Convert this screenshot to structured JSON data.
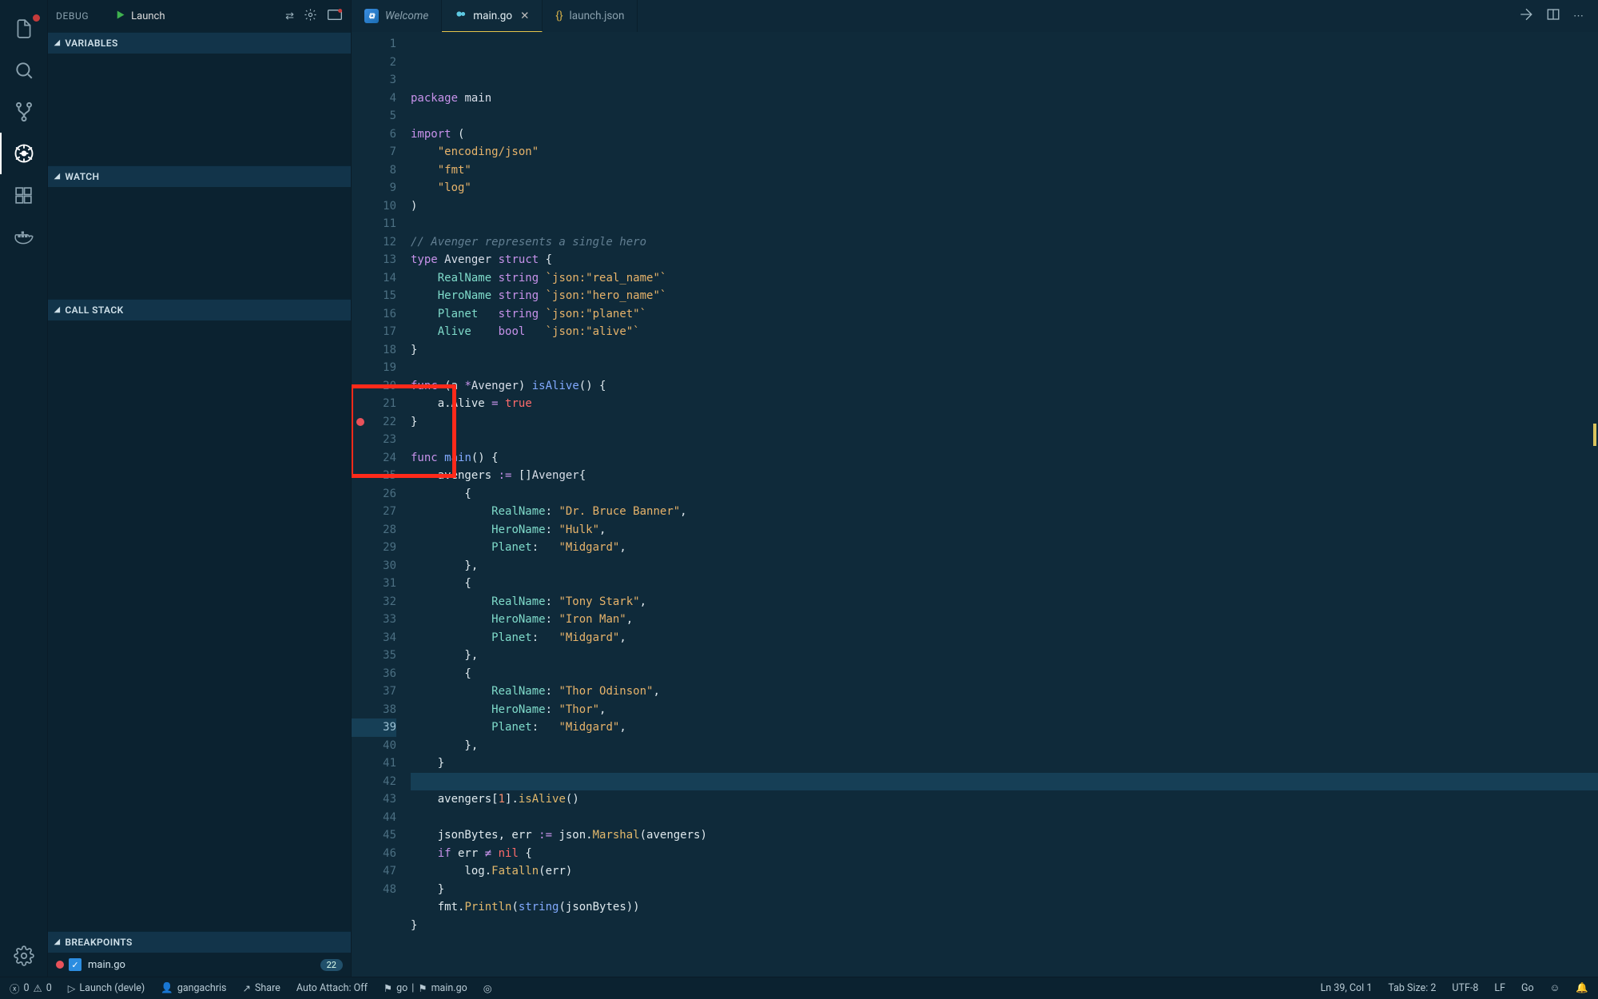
{
  "activity_bar": {
    "items": [
      "files",
      "search",
      "scm",
      "debug",
      "extensions",
      "docker"
    ],
    "active": "debug"
  },
  "sidebar": {
    "title": "DEBUG",
    "launch_config": "Launch",
    "sections": {
      "variables": "VARIABLES",
      "watch": "WATCH",
      "callstack": "CALL STACK",
      "breakpoints": "BREAKPOINTS"
    },
    "breakpoints": [
      {
        "file": "main.go",
        "line": 22,
        "enabled": true
      }
    ]
  },
  "tabs": [
    {
      "label": "Welcome",
      "icon": "vscode",
      "active": false,
      "italic": true
    },
    {
      "label": "main.go",
      "icon": "go",
      "active": true,
      "dirty": false,
      "closable": true
    },
    {
      "label": "launch.json",
      "icon": "json",
      "active": false
    }
  ],
  "editor": {
    "total_lines": 48,
    "current_line": 39,
    "breakpoint_lines": [
      22
    ],
    "code": [
      {
        "n": 1,
        "seg": [
          [
            "kw",
            "package"
          ],
          [
            "",
            " "
          ],
          [
            "pkg",
            "main"
          ]
        ]
      },
      {
        "n": 2,
        "seg": []
      },
      {
        "n": 3,
        "seg": [
          [
            "kw",
            "import"
          ],
          [
            "",
            " ("
          ]
        ]
      },
      {
        "n": 4,
        "seg": [
          [
            "",
            "    "
          ],
          [
            "str",
            "\"encoding/json\""
          ]
        ]
      },
      {
        "n": 5,
        "seg": [
          [
            "",
            "    "
          ],
          [
            "str",
            "\"fmt\""
          ]
        ]
      },
      {
        "n": 6,
        "seg": [
          [
            "",
            "    "
          ],
          [
            "str",
            "\"log\""
          ]
        ]
      },
      {
        "n": 7,
        "seg": [
          [
            "",
            ")"
          ]
        ]
      },
      {
        "n": 8,
        "seg": []
      },
      {
        "n": 9,
        "seg": [
          [
            "cm",
            "// Avenger represents a single hero"
          ]
        ]
      },
      {
        "n": 10,
        "seg": [
          [
            "kw",
            "type"
          ],
          [
            "",
            " "
          ],
          [
            "st",
            "Avenger"
          ],
          [
            "",
            " "
          ],
          [
            "kw",
            "struct"
          ],
          [
            "",
            " {"
          ]
        ]
      },
      {
        "n": 11,
        "seg": [
          [
            "",
            "    "
          ],
          [
            "fld",
            "RealName"
          ],
          [
            "",
            " "
          ],
          [
            "ty",
            "string"
          ],
          [
            "",
            " "
          ],
          [
            "str",
            "`json:\"real_name\"`"
          ]
        ]
      },
      {
        "n": 12,
        "seg": [
          [
            "",
            "    "
          ],
          [
            "fld",
            "HeroName"
          ],
          [
            "",
            " "
          ],
          [
            "ty",
            "string"
          ],
          [
            "",
            " "
          ],
          [
            "str",
            "`json:\"hero_name\"`"
          ]
        ]
      },
      {
        "n": 13,
        "seg": [
          [
            "",
            "    "
          ],
          [
            "fld",
            "Planet"
          ],
          [
            "",
            "   "
          ],
          [
            "ty",
            "string"
          ],
          [
            "",
            " "
          ],
          [
            "str",
            "`json:\"planet\"`"
          ]
        ]
      },
      {
        "n": 14,
        "seg": [
          [
            "",
            "    "
          ],
          [
            "fld",
            "Alive"
          ],
          [
            "",
            "    "
          ],
          [
            "ty",
            "bool"
          ],
          [
            "",
            "   "
          ],
          [
            "str",
            "`json:\"alive\"`"
          ]
        ]
      },
      {
        "n": 15,
        "seg": [
          [
            "",
            "}"
          ]
        ]
      },
      {
        "n": 16,
        "seg": []
      },
      {
        "n": 17,
        "seg": [
          [
            "kw",
            "func"
          ],
          [
            "",
            " (a "
          ],
          [
            "op",
            "*"
          ],
          [
            "st",
            "Avenger"
          ],
          [
            "",
            ") "
          ],
          [
            "fn",
            "isAlive"
          ],
          [
            "",
            "() {"
          ]
        ]
      },
      {
        "n": 18,
        "seg": [
          [
            "",
            "    a.Alive "
          ],
          [
            "op",
            "="
          ],
          [
            "",
            " "
          ],
          [
            "bool",
            "true"
          ]
        ]
      },
      {
        "n": 19,
        "seg": [
          [
            "",
            "}"
          ]
        ]
      },
      {
        "n": 20,
        "seg": []
      },
      {
        "n": 21,
        "seg": [
          [
            "kw",
            "func"
          ],
          [
            "",
            " "
          ],
          [
            "fn",
            "main"
          ],
          [
            "",
            "() {"
          ]
        ]
      },
      {
        "n": 22,
        "seg": [
          [
            "",
            "    avengers "
          ],
          [
            "op",
            ":="
          ],
          [
            "",
            " []"
          ],
          [
            "st",
            "Avenger"
          ],
          [
            "",
            "{"
          ]
        ]
      },
      {
        "n": 23,
        "seg": [
          [
            "",
            "        {"
          ]
        ]
      },
      {
        "n": 24,
        "seg": [
          [
            "",
            "            "
          ],
          [
            "fld",
            "RealName"
          ],
          [
            "",
            ": "
          ],
          [
            "str",
            "\"Dr. Bruce Banner\""
          ],
          [
            "",
            ","
          ]
        ]
      },
      {
        "n": 25,
        "seg": [
          [
            "",
            "            "
          ],
          [
            "fld",
            "HeroName"
          ],
          [
            "",
            ": "
          ],
          [
            "str",
            "\"Hulk\""
          ],
          [
            "",
            ","
          ]
        ]
      },
      {
        "n": 26,
        "seg": [
          [
            "",
            "            "
          ],
          [
            "fld",
            "Planet"
          ],
          [
            "",
            ":   "
          ],
          [
            "str",
            "\"Midgard\""
          ],
          [
            "",
            ","
          ]
        ]
      },
      {
        "n": 27,
        "seg": [
          [
            "",
            "        },"
          ]
        ]
      },
      {
        "n": 28,
        "seg": [
          [
            "",
            "        {"
          ]
        ]
      },
      {
        "n": 29,
        "seg": [
          [
            "",
            "            "
          ],
          [
            "fld",
            "RealName"
          ],
          [
            "",
            ": "
          ],
          [
            "str",
            "\"Tony Stark\""
          ],
          [
            "",
            ","
          ]
        ]
      },
      {
        "n": 30,
        "seg": [
          [
            "",
            "            "
          ],
          [
            "fld",
            "HeroName"
          ],
          [
            "",
            ": "
          ],
          [
            "str",
            "\"Iron Man\""
          ],
          [
            "",
            ","
          ]
        ]
      },
      {
        "n": 31,
        "seg": [
          [
            "",
            "            "
          ],
          [
            "fld",
            "Planet"
          ],
          [
            "",
            ":   "
          ],
          [
            "str",
            "\"Midgard\""
          ],
          [
            "",
            ","
          ]
        ]
      },
      {
        "n": 32,
        "seg": [
          [
            "",
            "        },"
          ]
        ]
      },
      {
        "n": 33,
        "seg": [
          [
            "",
            "        {"
          ]
        ]
      },
      {
        "n": 34,
        "seg": [
          [
            "",
            "            "
          ],
          [
            "fld",
            "RealName"
          ],
          [
            "",
            ": "
          ],
          [
            "str",
            "\"Thor Odinson\""
          ],
          [
            "",
            ","
          ]
        ]
      },
      {
        "n": 35,
        "seg": [
          [
            "",
            "            "
          ],
          [
            "fld",
            "HeroName"
          ],
          [
            "",
            ": "
          ],
          [
            "str",
            "\"Thor\""
          ],
          [
            "",
            ","
          ]
        ]
      },
      {
        "n": 36,
        "seg": [
          [
            "",
            "            "
          ],
          [
            "fld",
            "Planet"
          ],
          [
            "",
            ":   "
          ],
          [
            "str",
            "\"Midgard\""
          ],
          [
            "",
            ","
          ]
        ]
      },
      {
        "n": 37,
        "seg": [
          [
            "",
            "        },"
          ]
        ]
      },
      {
        "n": 38,
        "seg": [
          [
            "",
            "    }"
          ]
        ]
      },
      {
        "n": 39,
        "seg": [
          [
            "",
            " "
          ]
        ]
      },
      {
        "n": 40,
        "seg": [
          [
            "",
            "    avengers["
          ],
          [
            "num",
            "1"
          ],
          [
            "",
            "]."
          ],
          [
            "callfn",
            "isAlive"
          ],
          [
            "",
            "()"
          ]
        ]
      },
      {
        "n": 41,
        "seg": []
      },
      {
        "n": 42,
        "seg": [
          [
            "",
            "    jsonBytes, err "
          ],
          [
            "op",
            ":="
          ],
          [
            "",
            " json."
          ],
          [
            "callfn",
            "Marshal"
          ],
          [
            "",
            "(avengers)"
          ]
        ]
      },
      {
        "n": 43,
        "seg": [
          [
            "",
            "    "
          ],
          [
            "kw",
            "if"
          ],
          [
            "",
            " err "
          ],
          [
            "op",
            "≠"
          ],
          [
            "",
            " "
          ],
          [
            "bool",
            "nil"
          ],
          [
            "",
            " {"
          ]
        ]
      },
      {
        "n": 44,
        "seg": [
          [
            "",
            "        log."
          ],
          [
            "callfn",
            "Fatalln"
          ],
          [
            "",
            "(err)"
          ]
        ]
      },
      {
        "n": 45,
        "seg": [
          [
            "",
            "    }"
          ]
        ]
      },
      {
        "n": 46,
        "seg": [
          [
            "",
            "    fmt."
          ],
          [
            "callfn",
            "Println"
          ],
          [
            "",
            "("
          ],
          [
            "fn",
            "string"
          ],
          [
            "",
            "(jsonBytes))"
          ]
        ]
      },
      {
        "n": 47,
        "seg": [
          [
            "",
            "}"
          ]
        ]
      },
      {
        "n": 48,
        "seg": []
      }
    ]
  },
  "annotation": {
    "red_box_gutter_lines": [
      21,
      24
    ]
  },
  "status_bar": {
    "errors": "0",
    "warnings": "0",
    "launch": "Launch (devle)",
    "user": "gangachris",
    "share": "Share",
    "auto_attach": "Auto Attach: Off",
    "lang_status": "go",
    "file": "main.go",
    "cursor": "Ln 39, Col 1",
    "tab_size": "Tab Size: 2",
    "encoding": "UTF-8",
    "eol": "LF",
    "language": "Go"
  }
}
